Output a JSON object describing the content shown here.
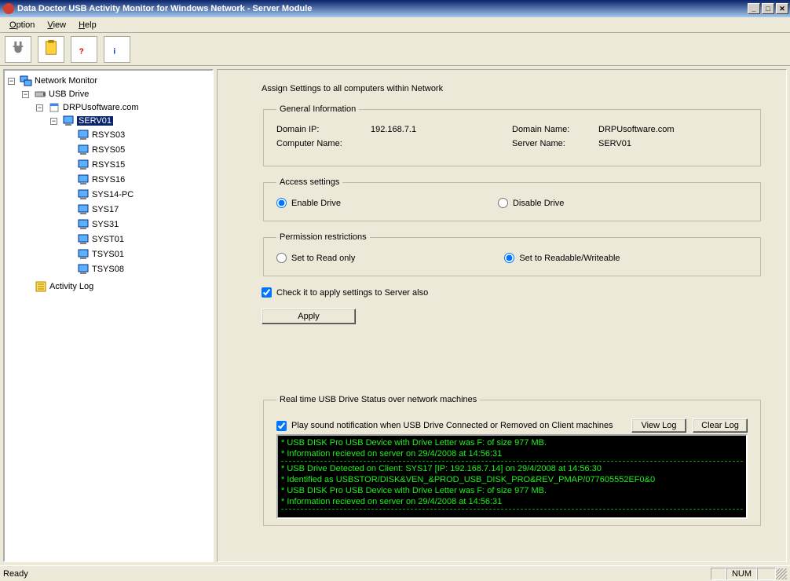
{
  "titlebar": {
    "title": "Data Doctor USB Activity Monitor for Windows Network - Server Module"
  },
  "menu": {
    "option": "Option",
    "view": "View",
    "help": "Help"
  },
  "tree": {
    "root": "Network Monitor",
    "usb_drive": "USB Drive",
    "domain": "DRPUsoftware.com",
    "server": "SERV01",
    "clients": [
      "RSYS03",
      "RSYS05",
      "RSYS15",
      "RSYS16",
      "SYS14-PC",
      "SYS17",
      "SYS31",
      "SYST01",
      "TSYS01",
      "TSYS08"
    ],
    "activity_log": "Activity Log"
  },
  "content": {
    "heading": "Assign Settings to all computers within Network",
    "general": {
      "legend": "General Information",
      "domain_ip_lbl": "Domain IP:",
      "domain_ip": "192.168.7.1",
      "domain_name_lbl": "Domain Name:",
      "domain_name": "DRPUsoftware.com",
      "computer_name_lbl": "Computer Name:",
      "computer_name": "",
      "server_name_lbl": "Server Name:",
      "server_name": "SERV01"
    },
    "access": {
      "legend": "Access settings",
      "enable": "Enable Drive",
      "disable": "Disable Drive"
    },
    "permission": {
      "legend": "Permission restrictions",
      "readonly": "Set to Read only",
      "readwrite": "Set to Readable/Writeable"
    },
    "apply_server_chk": "Check it to apply settings to Server also",
    "apply_btn": "Apply",
    "log_section": {
      "legend": "Real time USB Drive Status over network machines",
      "sound_chk": "Play sound notification when USB Drive Connected or Removed on Client machines",
      "view_log": "View Log",
      "clear_log": "Clear Log",
      "entries": [
        "* USB DISK Pro USB Device  with Drive Letter was F: of size 977 MB.",
        "* Information recieved on server on 29/4/2008 at 14:56:31",
        "---",
        "* USB Drive Detected on Client: SYS17 [IP: 192.168.7.14] on 29/4/2008 at 14:56:30",
        "* Identified as USBSTOR/DISK&VEN_&PROD_USB_DISK_PRO&REV_PMAP/077605552EF0&0",
        "* USB DISK Pro USB Device  with Drive Letter was F: of size 977 MB.",
        "* Information recieved on server on 29/4/2008 at 14:56:31",
        "---"
      ]
    }
  },
  "statusbar": {
    "ready": "Ready",
    "num": "NUM"
  }
}
